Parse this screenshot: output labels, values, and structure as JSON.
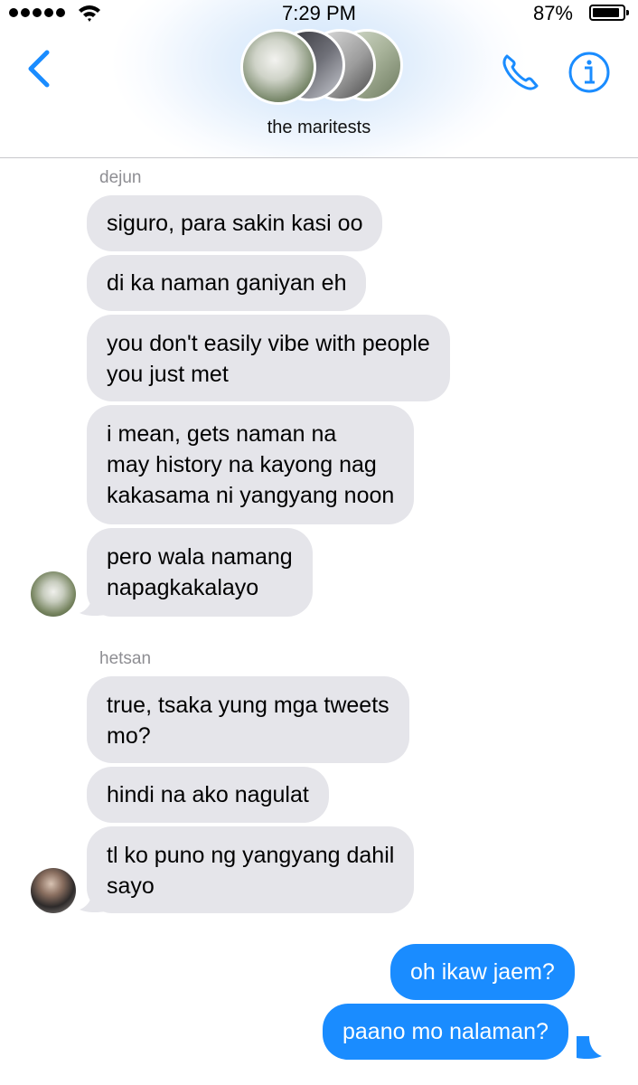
{
  "status_bar": {
    "time": "7:29 PM",
    "battery": "87%"
  },
  "header": {
    "group_name": "the maritests",
    "icons": [
      "back-chevron-icon",
      "phone-icon",
      "info-icon"
    ]
  },
  "colors": {
    "accent": "#1a8cff",
    "incoming_bubble": "#e5e5ea",
    "sender_label": "#8e8e93"
  },
  "messages": [
    {
      "sender": "dejun",
      "text": "siguro, para sakin kasi oo"
    },
    {
      "text": "di ka naman ganiyan eh"
    },
    {
      "text": "you don't easily vibe with people\nyou just met"
    },
    {
      "text": "i mean, gets naman na\nmay history na kayong nag\nkakasama ni yangyang noon"
    },
    {
      "text": "pero wala namang\nnapagkakalayo"
    },
    {
      "sender": "hetsan",
      "text": "true, tsaka yung mga tweets\nmo?"
    },
    {
      "text": "hindi na ako nagulat"
    },
    {
      "text": "tl ko puno ng yangyang dahil\nsayo"
    },
    {
      "text": "oh ikaw jaem?",
      "outgoing": true
    },
    {
      "text": "paano mo nalaman?",
      "outgoing": true
    }
  ]
}
